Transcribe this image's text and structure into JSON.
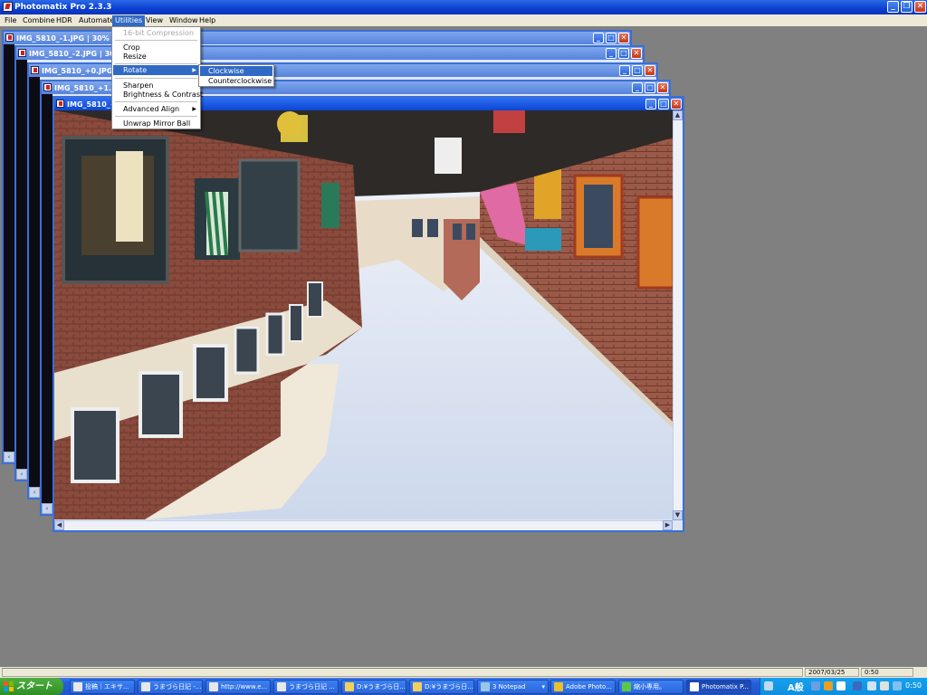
{
  "app": {
    "title": "Photomatix Pro 2.3.3"
  },
  "menubar": [
    "File",
    "Combine",
    "HDR",
    "Automate",
    "Utilities",
    "View",
    "Window",
    "Help"
  ],
  "windows": [
    {
      "title": "IMG_5810_-1.JPG | 30% | 3"
    },
    {
      "title": "IMG_5810_-2.JPG | 30"
    },
    {
      "title": "IMG_5810_+0.JPG"
    },
    {
      "title": "IMG_5810_+1.J"
    },
    {
      "title": "IMG_5810_+"
    }
  ],
  "utilities_menu": {
    "items": [
      "16-bit Compression",
      "Crop",
      "Resize",
      "Rotate",
      "Sharpen",
      "Brightness & Contrast",
      "Advanced Align",
      "Unwrap Mirror Ball"
    ],
    "disabled": "16-bit Compression",
    "highlighted": "Rotate"
  },
  "rotate_submenu": {
    "items": [
      "Clockwise",
      "Counterclockwise"
    ],
    "highlighted": "Clockwise"
  },
  "statusbar": {
    "date": "2007/03/25",
    "time": "0:50"
  },
  "taskbar": {
    "start_label": "スタート",
    "buttons": [
      "投稿｜エキサ...",
      "うまづら日記 -...",
      "http://www.e...",
      "うまづら日記 ...",
      "D:¥うまづら日...",
      "D:¥うまづら日...",
      "3 Notepad",
      "Adobe Photo...",
      "縮小専用。",
      "Photomatix P..."
    ],
    "ime": "A般",
    "clock": "0:50"
  },
  "colors": {
    "title_active": "#0b45d4",
    "menu_highlight": "#316ac5",
    "workspace": "#808080",
    "taskbar": "#245edb",
    "start_button": "#3c9c30"
  }
}
